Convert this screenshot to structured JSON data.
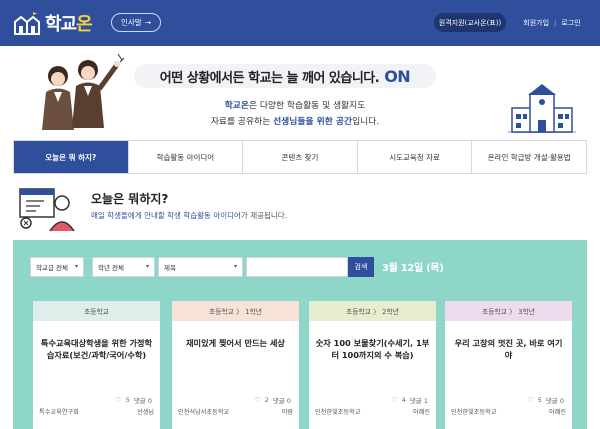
{
  "header": {
    "logo_text_a": "학교",
    "logo_text_b": "온",
    "greeting_button": "인사말",
    "remote_button": "원격지원(교사온(표))",
    "signup_link": "회원가입",
    "login_link": "로그인",
    "bg_color": "#2f4f9d"
  },
  "hero": {
    "headline": "어떤 상황에서든 학교는 늘 깨어 있습니다.",
    "headline_on": "ON",
    "sub_line1_a": "학교온",
    "sub_line1_b": "은 다양한 학습활동 및 생활지도",
    "sub_line2_a": "자료를 공유하는 ",
    "sub_line2_b": "선생님들을 위한 공간",
    "sub_line2_c": "입니다."
  },
  "tabs": [
    {
      "label": "오늘은 뭐 하지?",
      "active": true
    },
    {
      "label": "학습활동 아이디어",
      "active": false
    },
    {
      "label": "콘텐츠 찾기",
      "active": false
    },
    {
      "label": "시도교육청 자료",
      "active": false
    },
    {
      "label": "온라인 학급방 개설·활용법",
      "active": false
    }
  ],
  "section": {
    "title": "오늘은 뭐하지?",
    "desc_a": "매일 학생들에게 안내할 학생 학습활동 아이디어",
    "desc_b": "가 제공됩니다."
  },
  "filters": {
    "school_level": "학교급 전체",
    "grade": "학년 전체",
    "field": "제목",
    "search_value": "",
    "search_button": "검색",
    "date": "3월 12일 (목)",
    "panel_color": "#8ed6c8"
  },
  "cards": [
    {
      "category": "초등학교",
      "title": "특수교육대상학생을 위한 가정학습자료(보건/과학/국어/수학)",
      "likes": "5",
      "comments": "댓글 0",
      "org": "특수교육연구회",
      "author": "선생님",
      "head_color": "#dfeeea"
    },
    {
      "category": "초등학교 〉 1학년",
      "title": "재미있게 찢어서 만드는 세상",
      "likes": "2",
      "comments": "댓글 0",
      "org": "인천석남서초등학교",
      "author": "이람",
      "head_color": "#f6e2d7"
    },
    {
      "category": "초등학교 〉 2학년",
      "title": "숫자 100 보물찾기(수세기, 1부터 100까지의 수 복습)",
      "likes": "4",
      "comments": "댓글 1",
      "org": "인천한빛초등학교",
      "author": "이혜진",
      "head_color": "#e8edcf"
    },
    {
      "category": "초등학교 〉 3학년",
      "title": "우리 고장의 멋진 곳, 바로 여기야",
      "likes": "5",
      "comments": "댓글 0",
      "org": "인천한빛초등학교",
      "author": "이혜진",
      "head_color": "#ecdcee"
    }
  ]
}
